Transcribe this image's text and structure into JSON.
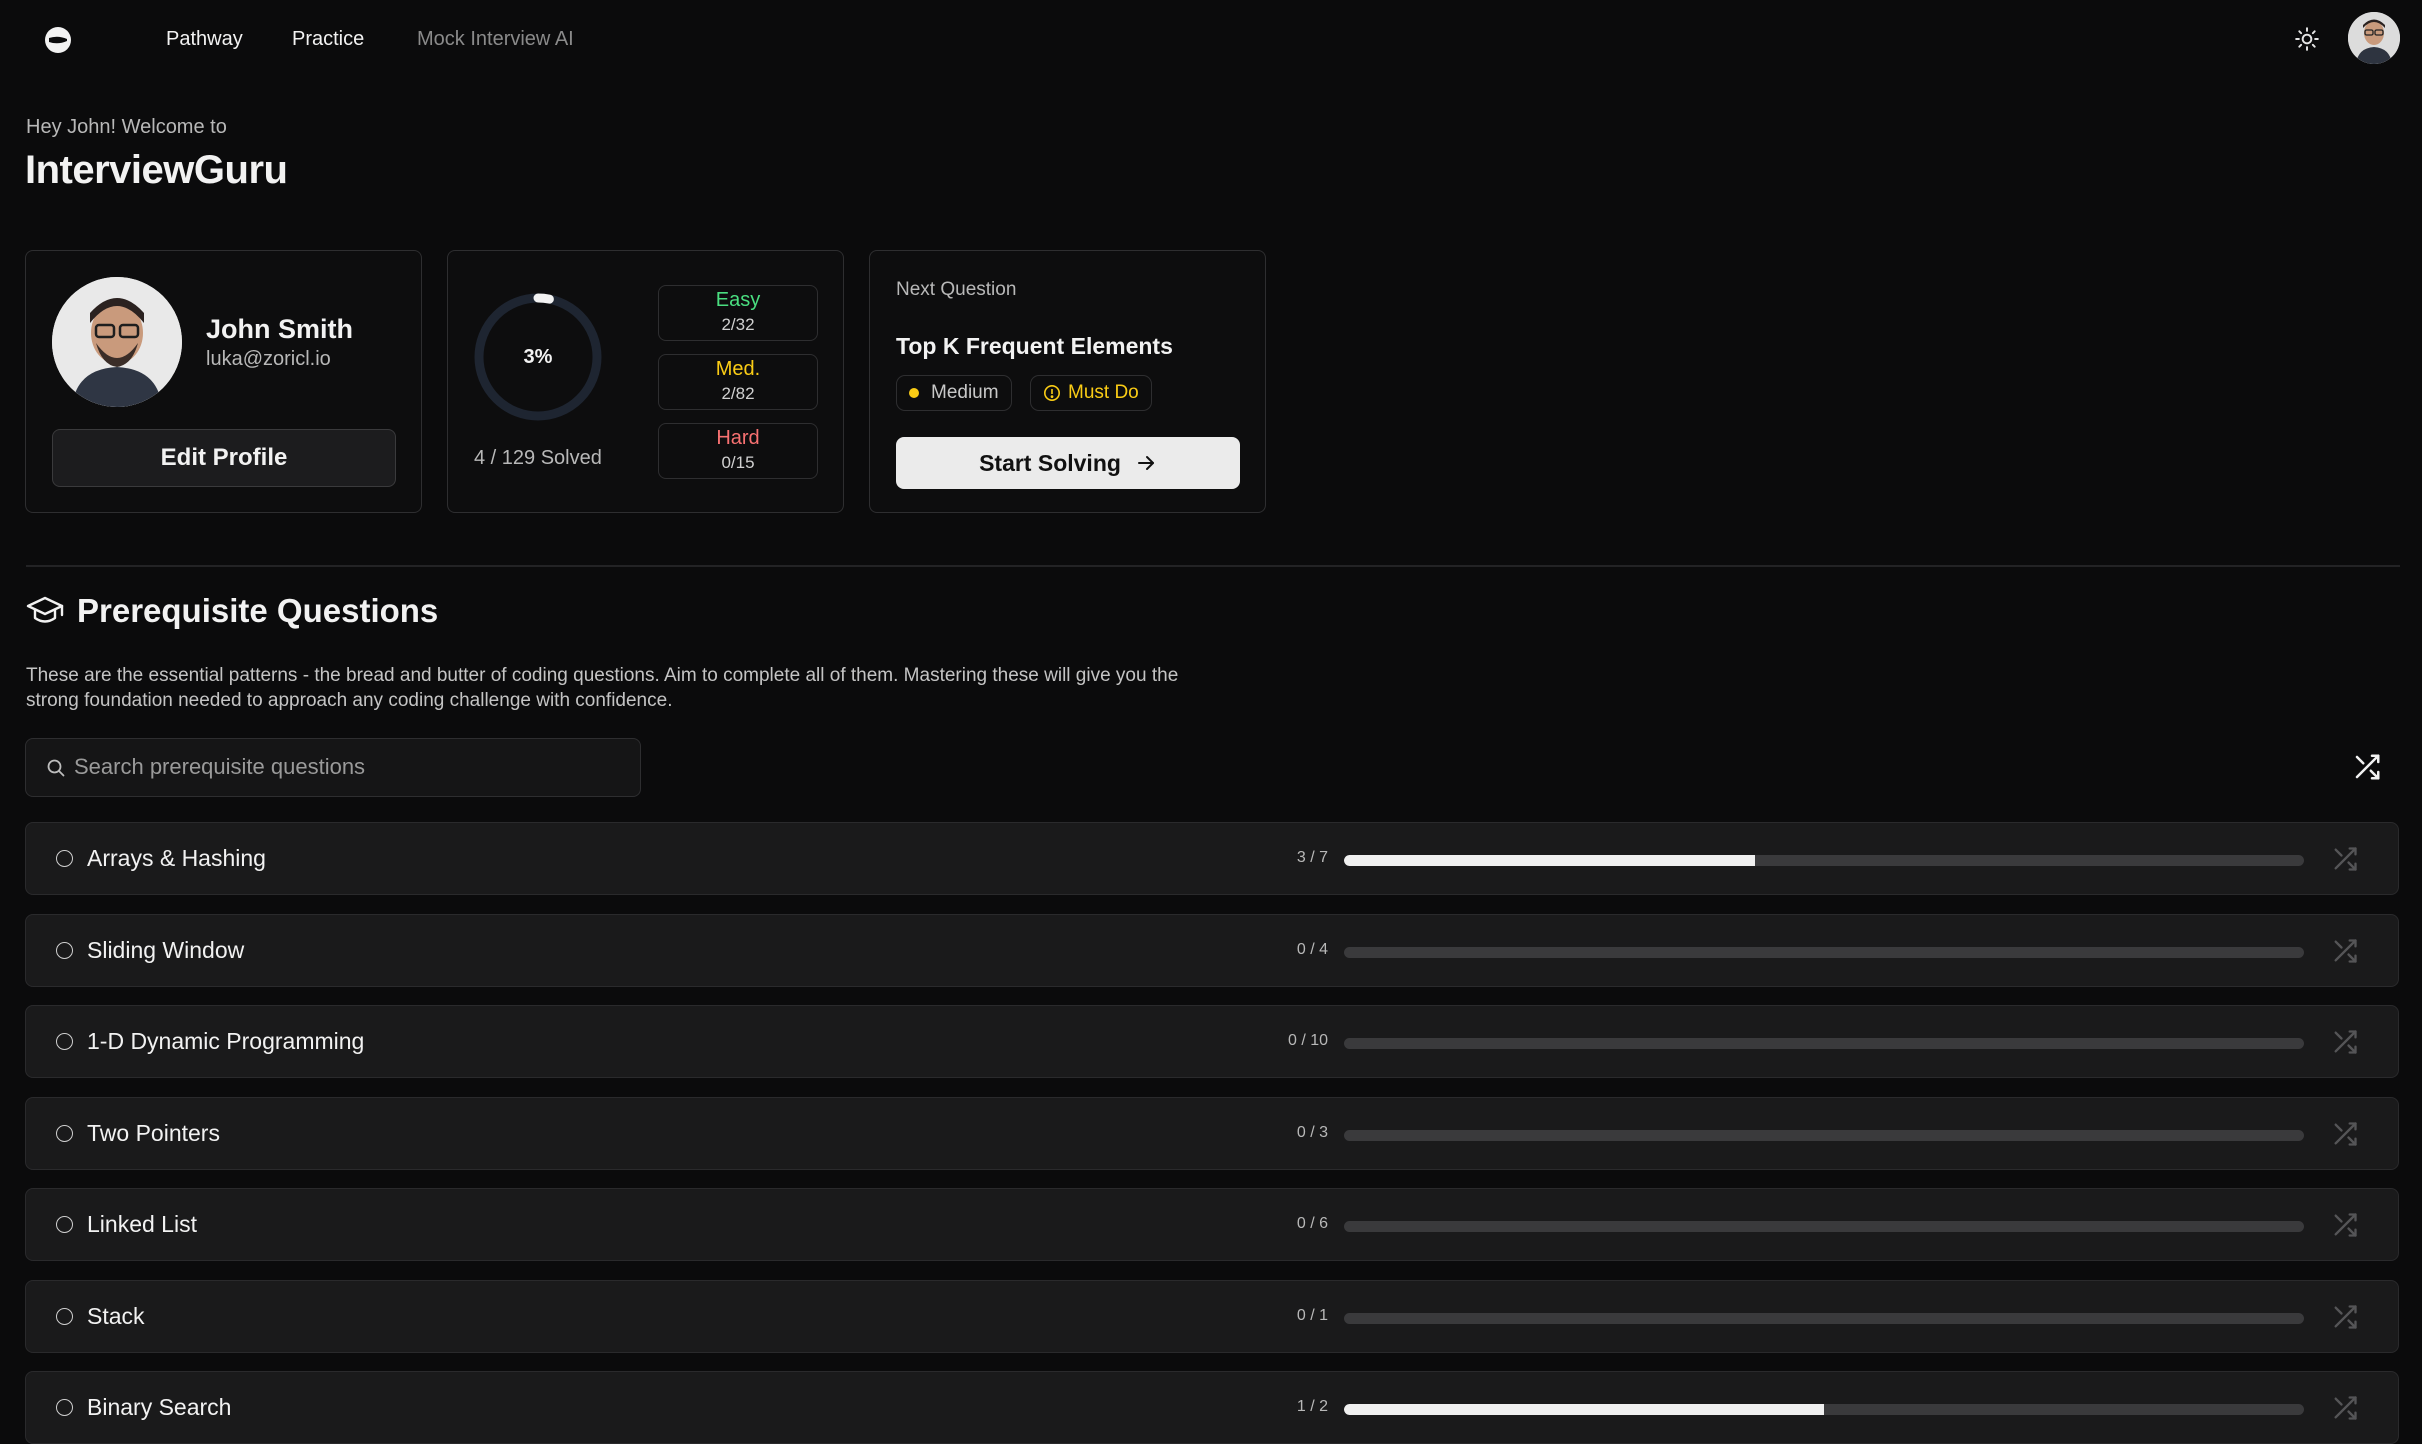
{
  "nav": {
    "links": [
      {
        "label": "Pathway"
      },
      {
        "label": "Practice"
      },
      {
        "label": "Mock Interview AI"
      }
    ],
    "icons": {
      "logo": "logo-icon",
      "theme": "sun-icon",
      "avatar": "user-avatar"
    }
  },
  "header": {
    "welcome": "Hey John! Welcome to",
    "brand": "InterviewGuru"
  },
  "profile": {
    "name": "John Smith",
    "email": "luka@zoricl.io",
    "edit_label": "Edit Profile"
  },
  "progress": {
    "percent_label": "3%",
    "percent_value": 0.031,
    "solved_label": "4 / 129 Solved",
    "difficulties": [
      {
        "label": "Easy",
        "count": "2/32",
        "color": "#4ade80"
      },
      {
        "label": "Med.",
        "count": "2/82",
        "color": "#facc15"
      },
      {
        "label": "Hard",
        "count": "0/15",
        "color": "#f87171"
      }
    ]
  },
  "next_question": {
    "heading": "Next Question",
    "title": "Top K Frequent Elements",
    "difficulty_tag": "Medium",
    "must_do_tag": "Must Do",
    "start_label": "Start Solving",
    "colors": {
      "medium_dot": "#facc15",
      "must_do": "#facc15"
    }
  },
  "prerequisites": {
    "title": "Prerequisite Questions",
    "description": "These are the essential patterns - the bread and butter of coding questions. Aim to complete all of them. Mastering these will give you the strong foundation needed to approach any coding challenge with confidence.",
    "search_placeholder": "Search prerequisite questions",
    "topics": [
      {
        "title": "Arrays & Hashing",
        "count": "3 / 7",
        "progress": 0.4286
      },
      {
        "title": "Sliding Window",
        "count": "0 / 4",
        "progress": 0
      },
      {
        "title": "1-D Dynamic Programming",
        "count": "0 / 10",
        "progress": 0
      },
      {
        "title": "Two Pointers",
        "count": "0 / 3",
        "progress": 0
      },
      {
        "title": "Linked List",
        "count": "0 / 6",
        "progress": 0
      },
      {
        "title": "Stack",
        "count": "0 / 1",
        "progress": 0
      },
      {
        "title": "Binary Search",
        "count": "1 / 2",
        "progress": 0.5
      }
    ]
  }
}
